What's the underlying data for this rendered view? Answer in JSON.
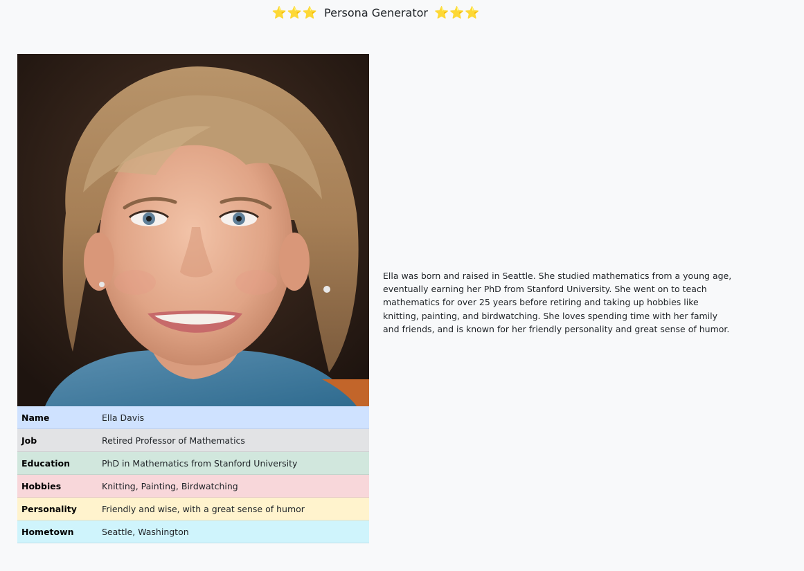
{
  "header": {
    "stars_left": "⭐⭐⭐",
    "title": "Persona Generator",
    "stars_right": "⭐⭐⭐"
  },
  "persona": {
    "photo_icon": "portrait-photo",
    "rows": [
      {
        "label": "Name",
        "value": "Ella Davis",
        "color": "#cfe2ff"
      },
      {
        "label": "Job",
        "value": "Retired Professor of Mathematics",
        "color": "#e2e3e5"
      },
      {
        "label": "Education",
        "value": "PhD in Mathematics from Stanford University",
        "color": "#d1e7dd"
      },
      {
        "label": "Hobbies",
        "value": "Knitting, Painting, Birdwatching",
        "color": "#f8d7da"
      },
      {
        "label": "Personality",
        "value": "Friendly and wise, with a great sense of humor",
        "color": "#fff3cd"
      },
      {
        "label": "Hometown",
        "value": "Seattle, Washington",
        "color": "#cff4fc"
      }
    ],
    "bio": "Ella was born and raised in Seattle. She studied mathematics from a young age, eventually earning her PhD from Stanford University. She went on to teach mathematics for over 25 years before retiring and taking up hobbies like knitting, painting, and birdwatching. She loves spending time with her family and friends, and is known for her friendly personality and great sense of humor."
  }
}
